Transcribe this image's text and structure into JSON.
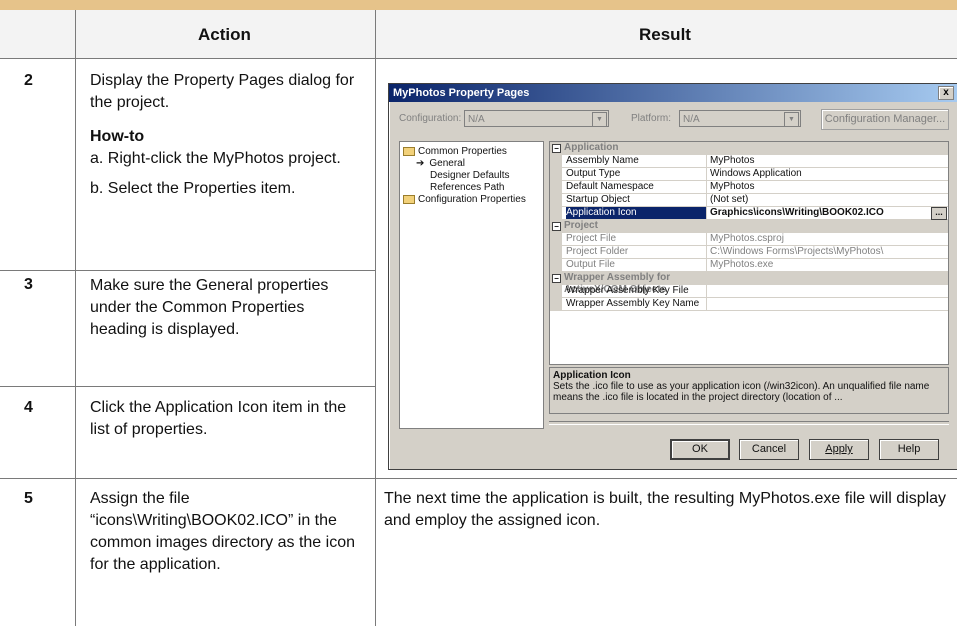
{
  "table": {
    "header_action": "Action",
    "header_result": "Result"
  },
  "steps": [
    {
      "num": "2",
      "text": "Display the Property Pages dialog for the project.",
      "howto": "How-to",
      "sub": [
        "a. Right-click the MyPhotos project.",
        "b. Select the Properties item."
      ]
    },
    {
      "num": "3",
      "text": "Make sure the General properties under the Common Properties heading is displayed."
    },
    {
      "num": "4",
      "text": "Click the Application Icon item in the list of properties."
    },
    {
      "num": "5",
      "text": "Assign the file “icons\\Writing\\BOOK02.ICO” in the common images directory as the icon for the application.",
      "result": "The next time the application is built, the resulting MyPhotos.exe file will display and employ the assigned icon."
    }
  ],
  "dialog": {
    "title": "MyPhotos Property Pages",
    "close": "x",
    "configuration_label": "Configuration:",
    "configuration_value": "N/A",
    "platform_label": "Platform:",
    "platform_value": "N/A",
    "config_manager_button": "Configuration Manager...",
    "tree": {
      "common": "Common Properties",
      "general": "General",
      "designer": "Designer Defaults",
      "refpath": "References Path",
      "config": "Configuration Properties"
    },
    "grid": {
      "cat_application": "Application",
      "rows_app": [
        {
          "name": "Assembly Name",
          "value": "MyPhotos"
        },
        {
          "name": "Output Type",
          "value": "Windows Application"
        },
        {
          "name": "Default Namespace",
          "value": "MyPhotos"
        },
        {
          "name": "Startup Object",
          "value": "(Not set)"
        },
        {
          "name": "Application Icon",
          "value": "Graphics\\icons\\Writing\\BOOK02.ICO"
        }
      ],
      "cat_project": "Project",
      "rows_project": [
        {
          "name": "Project File",
          "value": "MyPhotos.csproj"
        },
        {
          "name": "Project Folder",
          "value": "C:\\Windows Forms\\Projects\\MyPhotos\\"
        },
        {
          "name": "Output File",
          "value": "MyPhotos.exe"
        }
      ],
      "cat_wrapper": "Wrapper Assembly for ActiveX/COM Objects",
      "rows_wrapper": [
        {
          "name": "Wrapper Assembly Key File",
          "value": ""
        },
        {
          "name": "Wrapper Assembly Key Name",
          "value": ""
        }
      ],
      "ellipsis": "..."
    },
    "description": {
      "title": "Application Icon",
      "text": "Sets the .ico file to use as your application icon (/win32icon). An unqualified file name means the .ico file is located in the project directory (location of ..."
    },
    "buttons": {
      "ok": "OK",
      "cancel": "Cancel",
      "apply": "Apply",
      "help": "Help"
    }
  }
}
